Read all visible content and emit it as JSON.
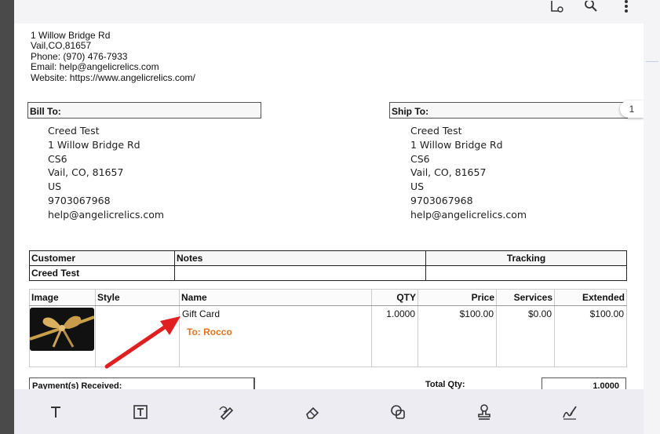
{
  "company_address": [
    "1 Willow Bridge Rd",
    "Vail,CO,81657",
    "Phone: (970) 476-7933",
    "Email: help@angelicrelics.com",
    "Website: https://www.angelicrelics.com/"
  ],
  "bill_to": {
    "label": "Bill To:",
    "lines": [
      "Creed Test",
      "1 Willow Bridge Rd",
      "CS6",
      "Vail, CO, 81657",
      "US",
      "9703067968",
      "help@angelicrelics.com"
    ]
  },
  "ship_to": {
    "label": "Ship To:",
    "lines": [
      "Creed Test",
      "1 Willow Bridge Rd",
      "CS6",
      "Vail, CO, 81657",
      "US",
      "9703067968",
      "help@angelicrelics.com"
    ]
  },
  "page_indicator": "1",
  "customer_table": {
    "headers": [
      "Customer",
      "Notes",
      "Tracking"
    ],
    "row": [
      "Creed Test",
      "",
      ""
    ]
  },
  "items_table": {
    "headers": [
      "Image",
      "Style",
      "Name",
      "QTY",
      "Price",
      "Services",
      "Extended"
    ],
    "rows": [
      {
        "image_icon": "gift-bow-image",
        "style": "",
        "name": "Gift Card",
        "note": "To: Rocco",
        "qty": "1.0000",
        "price": "$100.00",
        "services": "$0.00",
        "extended": "$100.00"
      }
    ]
  },
  "payments_label": "Payment(s) Received:",
  "total_qty_label": "Total Qty:",
  "total_qty_value": "1.0000",
  "toolbar_top_icons": [
    "document-settings-icon",
    "search-icon",
    "more-vertical-icon"
  ],
  "toolbar_bottom_icons": [
    "text-tool-icon",
    "text-box-tool-icon",
    "draw-tool-icon",
    "eraser-tool-icon",
    "shapes-tool-icon",
    "stamp-tool-icon",
    "signature-tool-icon"
  ],
  "colors": {
    "annotation_arrow": "#e02020",
    "note_text": "#e0731f",
    "toolbar_bg": "#eeecf3"
  }
}
